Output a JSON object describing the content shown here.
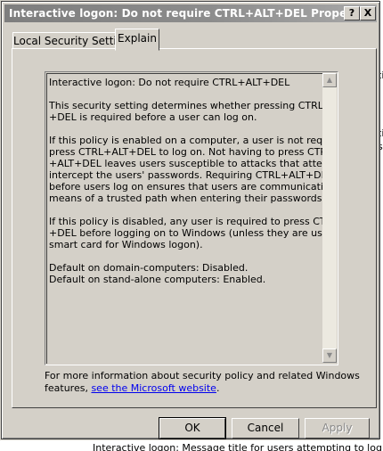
{
  "window": {
    "title": "Interactive logon: Do not require CTRL+ALT+DEL Properties",
    "help_button": "?",
    "close_button": "X"
  },
  "tabs": [
    {
      "label": "Local Security Setting",
      "active": false
    },
    {
      "label": "Explain",
      "active": true
    }
  ],
  "explain": {
    "heading": "Interactive logon: Do not require CTRL+ALT+DEL",
    "paragraph1": [
      "This security setting determines whether pressing CTRL+ALT",
      "+DEL is required before a user can log on."
    ],
    "paragraph2": [
      "If this policy is enabled on a computer, a user is not required to",
      "press CTRL+ALT+DEL to log on. Not having to press CTRL",
      "+ALT+DEL leaves users susceptible to attacks that attempt to",
      "intercept the users' passwords. Requiring CTRL+ALT+DEL",
      "before users log on ensures that users are communicating by",
      "means of a trusted path when entering their passwords."
    ],
    "paragraph3": [
      "If this policy is disabled, any user is required to press CTRL+ALT",
      "+DEL before logging on to Windows (unless they are using a",
      "smart card for Windows logon)."
    ],
    "defaults": [
      "Default on domain-computers: Disabled.",
      "Default on stand-alone computers: Enabled."
    ]
  },
  "footer": {
    "line1": "For more information about security policy and related Windows",
    "line2_prefix": "features, ",
    "link_text": "see the Microsoft website",
    "line2_suffix": "."
  },
  "buttons": {
    "ok": "OK",
    "cancel": "Cancel",
    "apply": "Apply"
  },
  "background": {
    "right_fragment_1": "ti",
    "right_fragment_2": "ti",
    "right_fragment_3": "st",
    "bottom_fragment": "Interactive logon: Message title for users attempting to log"
  }
}
